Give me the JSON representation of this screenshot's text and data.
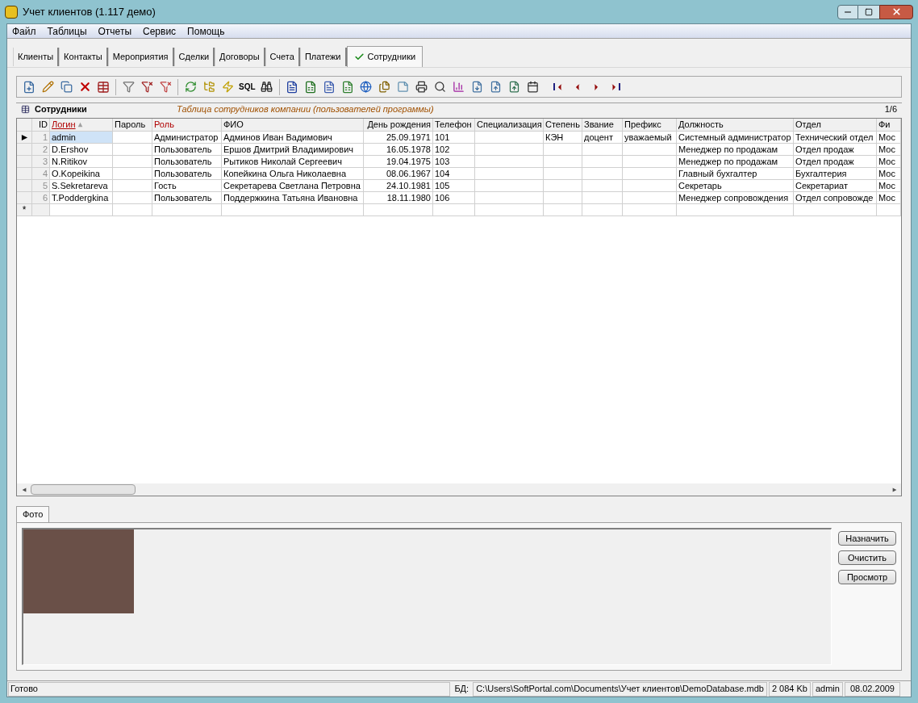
{
  "window": {
    "title": "Учет клиентов (1.117 демо)"
  },
  "menu": [
    "Файл",
    "Таблицы",
    "Отчеты",
    "Сервис",
    "Помощь"
  ],
  "tabs": [
    {
      "label": "Клиенты",
      "selected": false
    },
    {
      "label": "Контакты",
      "selected": false
    },
    {
      "label": "Мероприятия",
      "selected": false
    },
    {
      "label": "Сделки",
      "selected": false
    },
    {
      "label": "Договоры",
      "selected": false
    },
    {
      "label": "Счета",
      "selected": false
    },
    {
      "label": "Платежи",
      "selected": false
    },
    {
      "label": "Сотрудники",
      "selected": true
    }
  ],
  "toolbar": {
    "sql_label": "SQL"
  },
  "table_header": {
    "title": "Сотрудники",
    "description": "Таблица сотрудников компании (пользователей программы)",
    "record_counter": "1/6"
  },
  "table": {
    "columns": [
      {
        "label": "ID",
        "marked": false,
        "sorted": false,
        "kind": "number"
      },
      {
        "label": "Логин",
        "marked": true,
        "sorted": true,
        "kind": "text"
      },
      {
        "label": "Пароль",
        "marked": false,
        "sorted": false,
        "kind": "text"
      },
      {
        "label": "Роль",
        "marked": true,
        "sorted": false,
        "kind": "text"
      },
      {
        "label": "ФИО",
        "marked": false,
        "sorted": false,
        "kind": "text"
      },
      {
        "label": "День рождения",
        "marked": false,
        "sorted": false,
        "kind": "date"
      },
      {
        "label": "Телефон",
        "marked": false,
        "sorted": false,
        "kind": "text"
      },
      {
        "label": "Специализация",
        "marked": false,
        "sorted": false,
        "kind": "text"
      },
      {
        "label": "Степень",
        "marked": false,
        "sorted": false,
        "kind": "text"
      },
      {
        "label": "Звание",
        "marked": false,
        "sorted": false,
        "kind": "text"
      },
      {
        "label": "Префикс",
        "marked": false,
        "sorted": false,
        "kind": "text"
      },
      {
        "label": "Должность",
        "marked": false,
        "sorted": false,
        "kind": "text"
      },
      {
        "label": "Отдел",
        "marked": false,
        "sorted": false,
        "kind": "text"
      },
      {
        "label": "Фи",
        "marked": false,
        "sorted": false,
        "kind": "text"
      }
    ],
    "rows": [
      {
        "selected": true,
        "cells": [
          "1",
          "admin",
          "",
          "Администратор",
          "Админов Иван Вадимович",
          "25.09.1971",
          "101",
          "",
          "КЭН",
          "доцент",
          "уважаемый",
          "Системный администратор",
          "Технический отдел",
          "Мос"
        ]
      },
      {
        "selected": false,
        "cells": [
          "2",
          "D.Ershov",
          "",
          "Пользователь",
          "Ершов Дмитрий Владимирович",
          "16.05.1978",
          "102",
          "",
          "",
          "",
          "",
          "Менеджер по продажам",
          "Отдел продаж",
          "Мос"
        ]
      },
      {
        "selected": false,
        "cells": [
          "3",
          "N.Ritikov",
          "",
          "Пользователь",
          "Рытиков Николай Сергеевич",
          "19.04.1975",
          "103",
          "",
          "",
          "",
          "",
          "Менеджер по продажам",
          "Отдел продаж",
          "Мос"
        ]
      },
      {
        "selected": false,
        "cells": [
          "4",
          "O.Kopeikina",
          "",
          "Пользователь",
          "Копейкина Ольга Николаевна",
          "08.06.1967",
          "104",
          "",
          "",
          "",
          "",
          "Главный бухгалтер",
          "Бухгалтерия",
          "Мос"
        ]
      },
      {
        "selected": false,
        "cells": [
          "5",
          "S.Sekretareva",
          "",
          "Гость",
          "Секретарева Светлана Петровна",
          "24.10.1981",
          "105",
          "",
          "",
          "",
          "",
          "Секретарь",
          "Секретариат",
          "Мос"
        ]
      },
      {
        "selected": false,
        "cells": [
          "6",
          "T.Poddergkina",
          "",
          "Пользователь",
          "Поддержкина Татьяна Ивановна",
          "18.11.1980",
          "106",
          "",
          "",
          "",
          "",
          "Менеджер сопровождения",
          "Отдел сопровожде",
          "Мос"
        ]
      }
    ],
    "new_row_marker": "*"
  },
  "photo_panel": {
    "tab": "Фото",
    "buttons": [
      "Назначить",
      "Очистить",
      "Просмотр"
    ]
  },
  "status_bar": {
    "status": "Готово",
    "db_label": "БД:",
    "db_path": "C:\\Users\\SoftPortal.com\\Documents\\Учет клиентов\\DemoDatabase.mdb",
    "size": "2 084 Kb",
    "user": "admin",
    "date": "08.02.2009"
  }
}
